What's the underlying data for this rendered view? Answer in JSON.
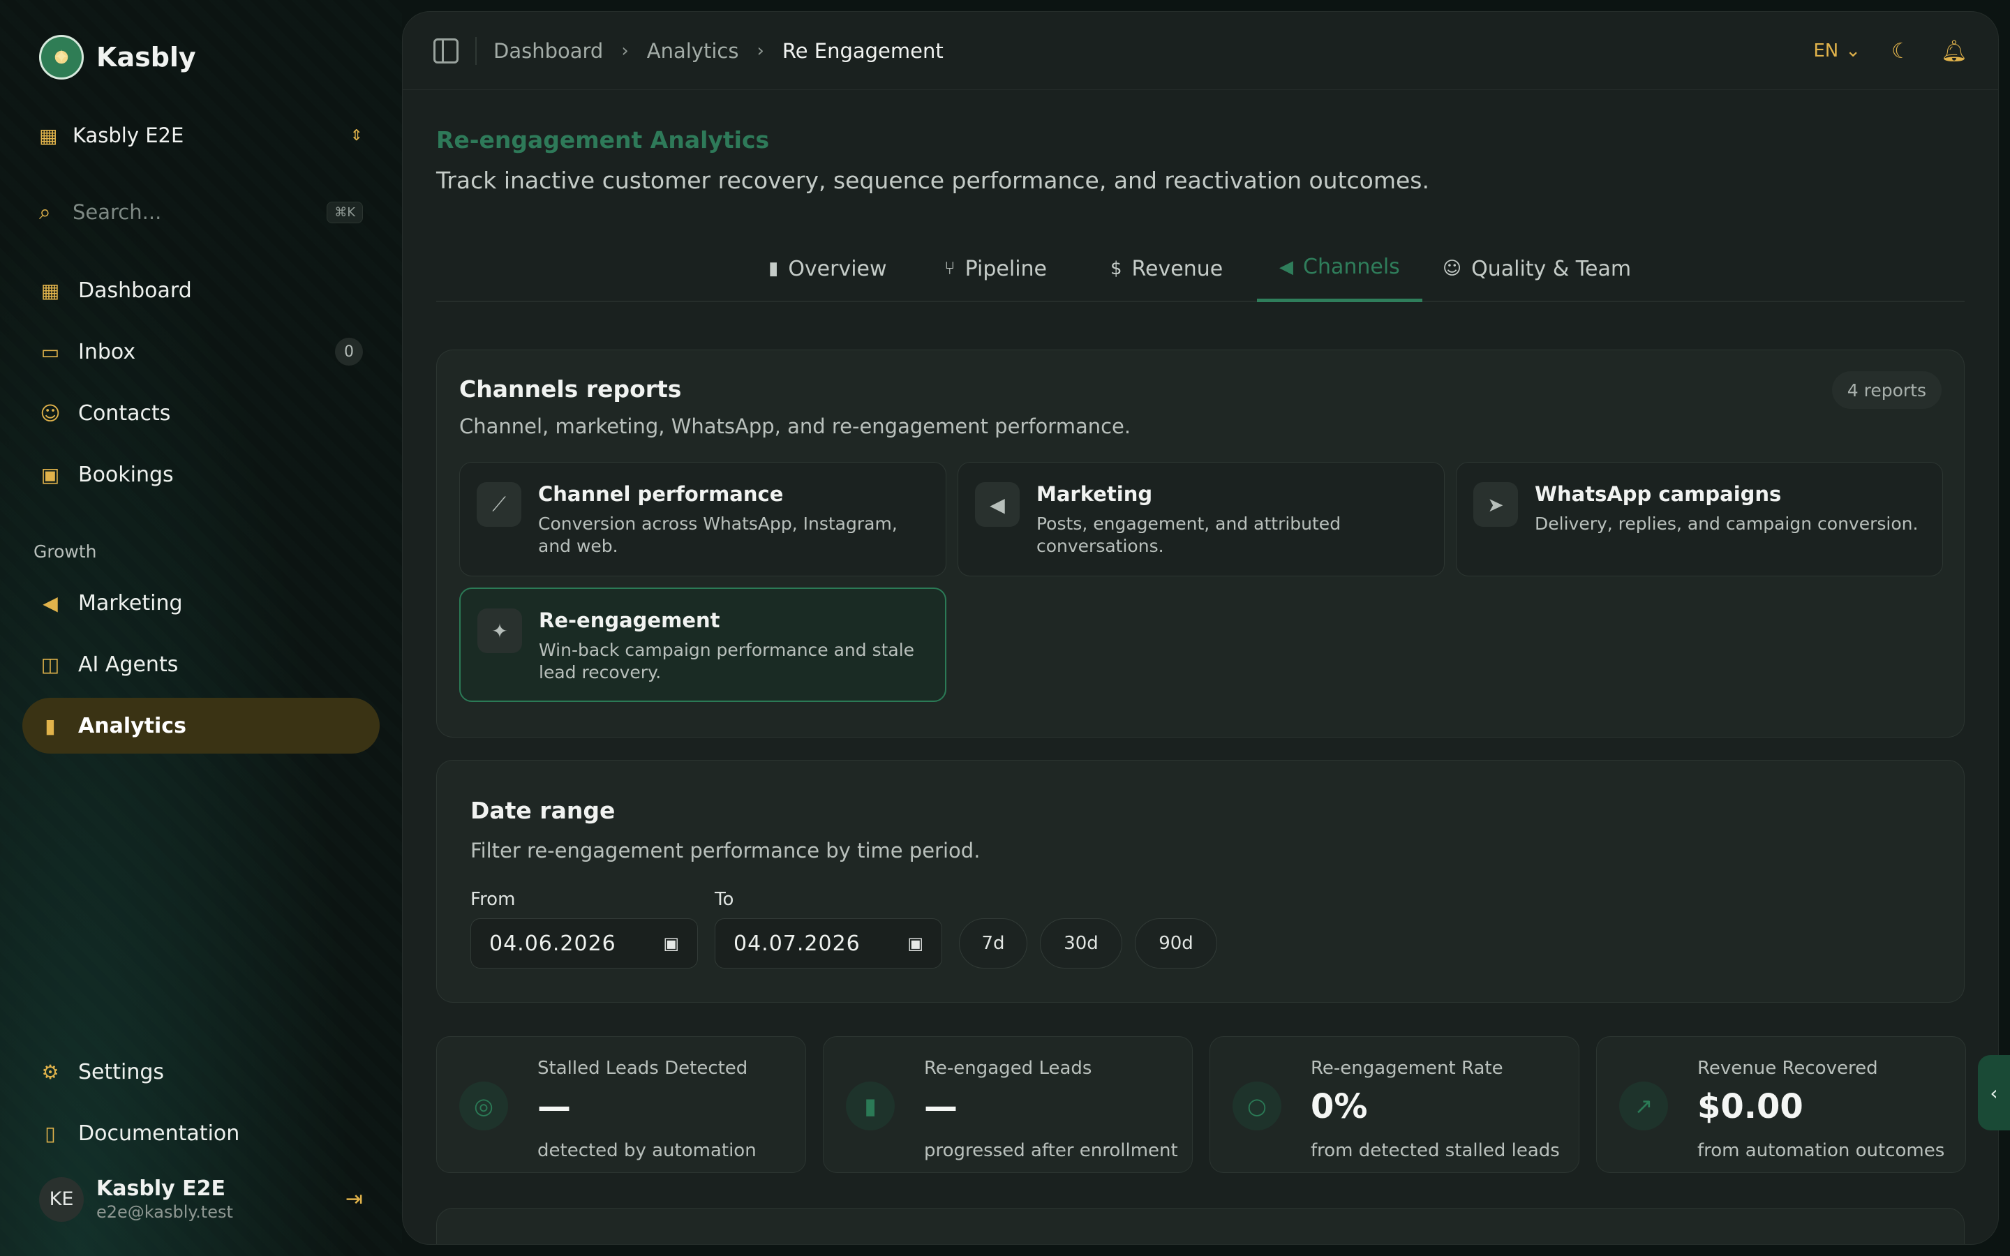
{
  "brand": {
    "name": "Kasbly"
  },
  "workspace": {
    "name": "Kasbly E2E"
  },
  "search": {
    "placeholder": "Search...",
    "shortcut": "⌘K"
  },
  "nav": {
    "dashboard": "Dashboard",
    "inbox": "Inbox",
    "inbox_count": "0",
    "contacts": "Contacts",
    "bookings": "Bookings",
    "growth_label": "Growth",
    "marketing": "Marketing",
    "ai_agents": "AI Agents",
    "analytics": "Analytics",
    "settings": "Settings",
    "documentation": "Documentation"
  },
  "user": {
    "name": "Kasbly E2E",
    "email": "e2e@kasbly.test",
    "initials": "KE"
  },
  "breadcrumb": [
    "Dashboard",
    "Analytics",
    "Re Engagement"
  ],
  "topbar": {
    "language": "EN"
  },
  "page": {
    "title": "Re-engagement Analytics",
    "subtitle": "Track inactive customer recovery, sequence performance, and reactivation outcomes."
  },
  "tabs": [
    {
      "label": "Overview",
      "icon": "bar-chart-icon"
    },
    {
      "label": "Pipeline",
      "icon": "git-branch-icon"
    },
    {
      "label": "Revenue",
      "icon": "dollar-circle-icon"
    },
    {
      "label": "Channels",
      "icon": "megaphone-icon",
      "active": true
    },
    {
      "label": "Quality & Team",
      "icon": "users-icon"
    }
  ],
  "reports": {
    "title": "Channels reports",
    "description": "Channel, marketing, WhatsApp, and re-engagement performance.",
    "badge": "4 reports",
    "items": [
      {
        "title": "Channel performance",
        "description": "Conversion across WhatsApp, Instagram, and web.",
        "icon": "line-chart-icon"
      },
      {
        "title": "Marketing",
        "description": "Posts, engagement, and attributed conversations.",
        "icon": "megaphone-icon"
      },
      {
        "title": "WhatsApp campaigns",
        "description": "Delivery, replies, and campaign conversion.",
        "icon": "send-icon"
      },
      {
        "title": "Re-engagement",
        "description": "Win-back campaign performance and stale lead recovery.",
        "icon": "sparkles-icon",
        "active": true
      }
    ]
  },
  "date_range": {
    "title": "Date range",
    "description": "Filter re-engagement performance by time period.",
    "from_label": "From",
    "from_value": "04.06.2026",
    "to_label": "To",
    "to_value": "04.07.2026",
    "presets": [
      "7d",
      "30d",
      "90d"
    ]
  },
  "stats": [
    {
      "label": "Stalled Leads Detected",
      "value": "—",
      "note": "detected by automation",
      "icon": "target-icon"
    },
    {
      "label": "Re-engaged Leads",
      "value": "—",
      "note": "progressed after enrollment",
      "icon": "bar-chart-icon"
    },
    {
      "label": "Re-engagement Rate",
      "value": "0%",
      "note": "from detected stalled leads",
      "icon": "message-circle-icon"
    },
    {
      "label": "Revenue Recovered",
      "value": "$0.00",
      "note": "from automation outcomes",
      "icon": "trending-up-icon"
    }
  ],
  "colors": {
    "accent_gold": "#e1b34b",
    "accent_green": "#2f7e5b",
    "background": "#0c1412"
  }
}
